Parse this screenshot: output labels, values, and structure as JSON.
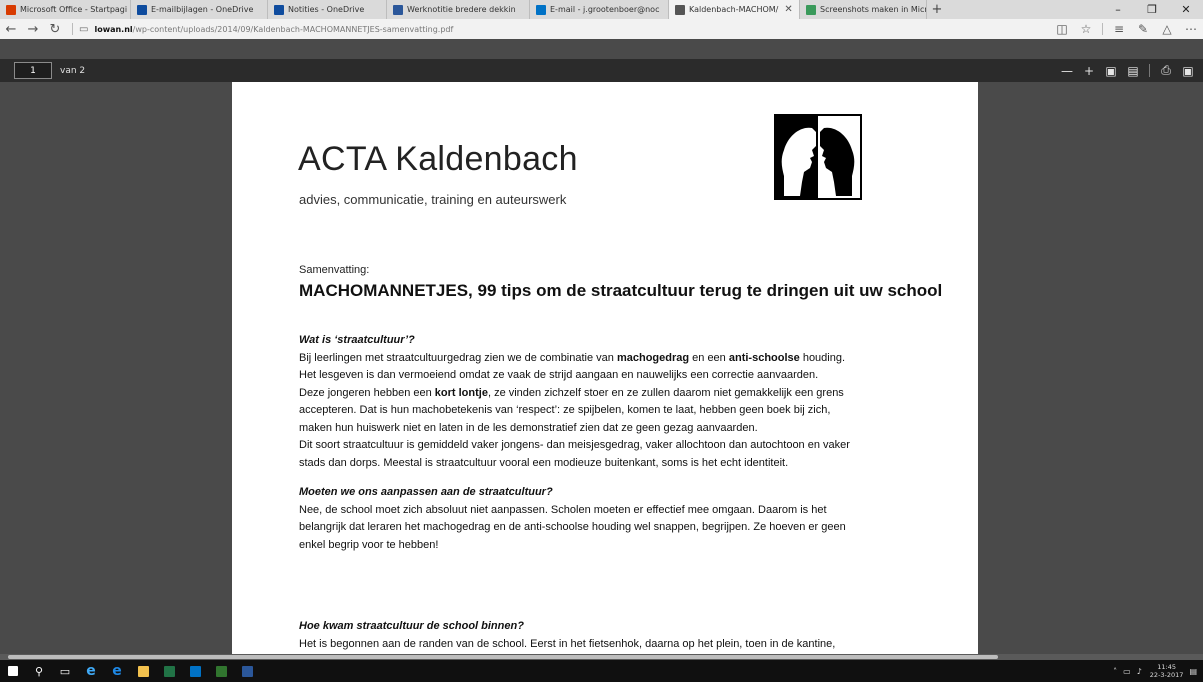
{
  "browser": {
    "tabs": [
      {
        "label": "Microsoft Office - Startpagi",
        "icon": "office-icon",
        "color": "#d83b01"
      },
      {
        "label": "E-mailbijlagen - OneDrive",
        "icon": "onedrive-icon",
        "color": "#0f4c9e"
      },
      {
        "label": "Notities - OneDrive",
        "icon": "onedrive-icon",
        "color": "#0f4c9e"
      },
      {
        "label": "Werknotitie bredere dekkin",
        "icon": "word-icon",
        "color": "#2b579a"
      },
      {
        "label": "E-mail - j.grootenboer@noc",
        "icon": "outlook-icon",
        "color": "#0072c6"
      },
      {
        "label": "Kaldenbach-MACHOM/",
        "icon": "page-icon",
        "color": "#555555",
        "active": true
      },
      {
        "label": "Screenshots maken in Micrc",
        "icon": "sway-icon",
        "color": "#3a9a5b"
      }
    ],
    "new_tab": "+",
    "url_host": "lowan.nl",
    "url_path": "/wp-content/uploads/2014/09/Kaldenbach-MACHOMANNETJES-samenvatting.pdf"
  },
  "pdf": {
    "page_current": "1",
    "page_total": "van 2"
  },
  "document": {
    "logo_title": "ACTA Kaldenbach",
    "logo_subtitle": "advies, communicatie, training en auteurswerk",
    "summary_label": "Samenvatting:",
    "title": "MACHOMANNETJES, 99 tips om de straatcultuur terug te dringen uit uw school",
    "sections": [
      {
        "heading": "Wat is ‘straatcultuur’?",
        "lines": [
          [
            "Bij leerlingen met straatcultuurgedrag  zien we de combinatie van ",
            "machogedrag",
            " en een ",
            "anti-schoolse",
            " houding."
          ],
          [
            "Het lesgeven is dan vermoeiend omdat ze vaak de strijd aangaan en nauwelijks een correctie aanvaarden."
          ],
          [
            "Deze jongeren hebben een ",
            "kort lontje",
            ", ze vinden zichzelf stoer en ze zullen daarom niet gemakkelijk een grens"
          ],
          [
            "accepteren. Dat is hun machobetekenis van ‘respect’: ze spijbelen, komen te laat, hebben geen boek bij zich,"
          ],
          [
            "maken hun huiswerk niet en laten in de les demonstratief zien dat ze geen gezag aanvaarden."
          ],
          [
            "Dit soort straatcultuur is gemiddeld vaker jongens- dan meisjesgedrag, vaker allochtoon dan autochtoon en vaker"
          ],
          [
            "stads dan dorps. Meestal is straatcultuur vooral een modieuze buitenkant, soms is het echt identiteit."
          ]
        ]
      },
      {
        "heading": "Moeten we ons aanpassen aan de straatcultuur?",
        "lines": [
          [
            "Nee, de school moet zich absoluut niet aanpassen. Scholen moeten er effectief mee omgaan. Daarom is het"
          ],
          [
            "belangrijk dat leraren het machogedrag en de anti-schoolse houding wel snappen, begrijpen. Ze hoeven er geen"
          ],
          [
            "enkel begrip voor te hebben!"
          ]
        ]
      },
      {
        "heading": "Hoe kwam straatcultuur de school binnen?",
        "lines": [
          [
            "Het is begonnen aan de randen van de school. Eerst in het fietsenhok, daarna op het plein, toen in de kantine,"
          ]
        ]
      }
    ]
  },
  "taskbar": {
    "time": "11:45",
    "date": "22-3-2017"
  }
}
